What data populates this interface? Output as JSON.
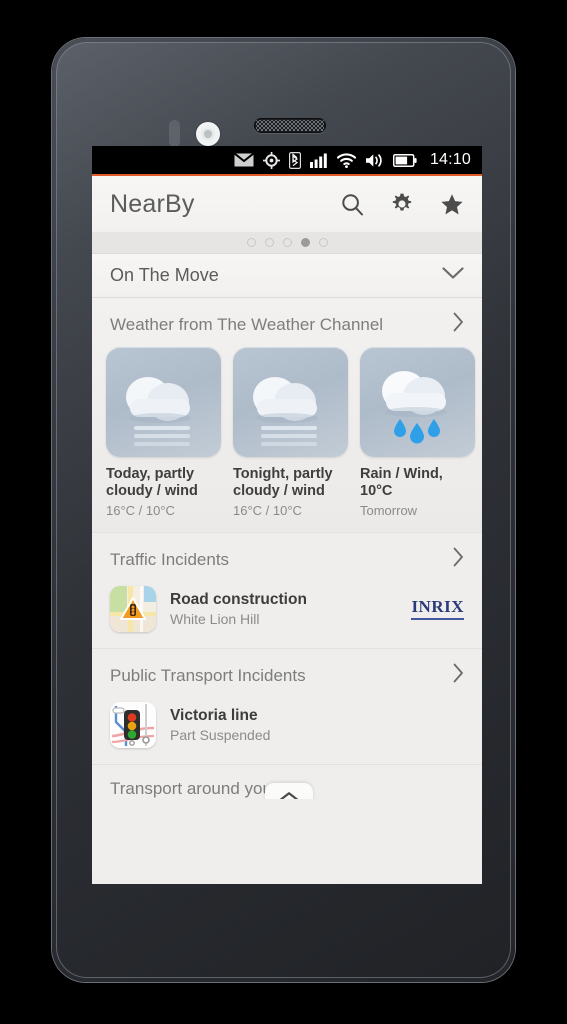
{
  "status_bar": {
    "time": "14:10",
    "icons": [
      "envelope-icon",
      "location-icon",
      "bluetooth-icon",
      "cellular-signal-icon",
      "wifi-icon",
      "volume-icon",
      "battery-icon"
    ]
  },
  "header": {
    "title": "NearBy",
    "actions": [
      {
        "name": "search-icon",
        "label": "Search"
      },
      {
        "name": "gear-icon",
        "label": "Settings"
      },
      {
        "name": "star-icon",
        "label": "Favourites"
      }
    ]
  },
  "page_indicator": {
    "total": 5,
    "active_index": 3
  },
  "scope_selector": {
    "label": "On The Move",
    "chevron": "chevron-down-icon"
  },
  "weather": {
    "section_title": "Weather from The Weather Channel",
    "chevron": "chevron-right-icon",
    "cards": [
      {
        "icon": "cloud-wind-icon",
        "title": "Today, partly cloudy / wind",
        "sub": "16°C / 10°C"
      },
      {
        "icon": "cloud-wind-icon",
        "title": "Tonight, partly cloudy / wind",
        "sub": "16°C / 10°C"
      },
      {
        "icon": "cloud-rain-icon",
        "title": "Rain / Wind, 10°C",
        "sub": "Tomorrow"
      }
    ]
  },
  "traffic": {
    "section_title": "Traffic Incidents",
    "chevron": "chevron-right-icon",
    "item": {
      "thumb": "road-map-warning-icon",
      "name": "Road construction",
      "desc": "White Lion Hill",
      "provider": "INRIX"
    }
  },
  "public_transport": {
    "section_title": "Public Transport Incidents",
    "chevron": "chevron-right-icon",
    "item": {
      "thumb": "tube-map-traffic-light-icon",
      "name": "Victoria line",
      "desc": "Part Suspended"
    }
  },
  "bottom_section": {
    "title": "Transport around you",
    "scroll_up": "chevron-up-icon"
  },
  "colors": {
    "accent": "#e05c2a",
    "screen_bg": "#efeeec",
    "status_bar_bg": "#000000",
    "weather_tile": "#aebbc9",
    "rain_drop": "#2f9fe8",
    "inrix_navy": "#2b3a78"
  }
}
